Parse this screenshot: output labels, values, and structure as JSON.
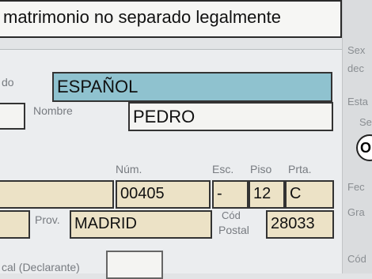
{
  "header": {
    "title": "matrimonio no separado legalmente"
  },
  "right_panel": {
    "labels": [
      "Sex",
      "dec",
      "Esta",
      "Se",
      "Fec",
      "Gra",
      "Cód"
    ],
    "radio_text": "O"
  },
  "form": {
    "nationality": {
      "label": "do",
      "value": "ESPAÑOL"
    },
    "name": {
      "label": "Nombre",
      "value": "PEDRO"
    },
    "address_headers": {
      "num": "Núm.",
      "esc": "Esc.",
      "piso": "Piso",
      "prta": "Prta."
    },
    "address": {
      "num": "00405",
      "esc": "-",
      "piso": "12",
      "prta": "C"
    },
    "province": {
      "label": "Prov.",
      "value": "MADRID"
    },
    "postal": {
      "label_line1": "Cód",
      "label_line2": "Postal",
      "value": "28033"
    },
    "declarant": {
      "label": "cal (Declarante)"
    }
  }
}
